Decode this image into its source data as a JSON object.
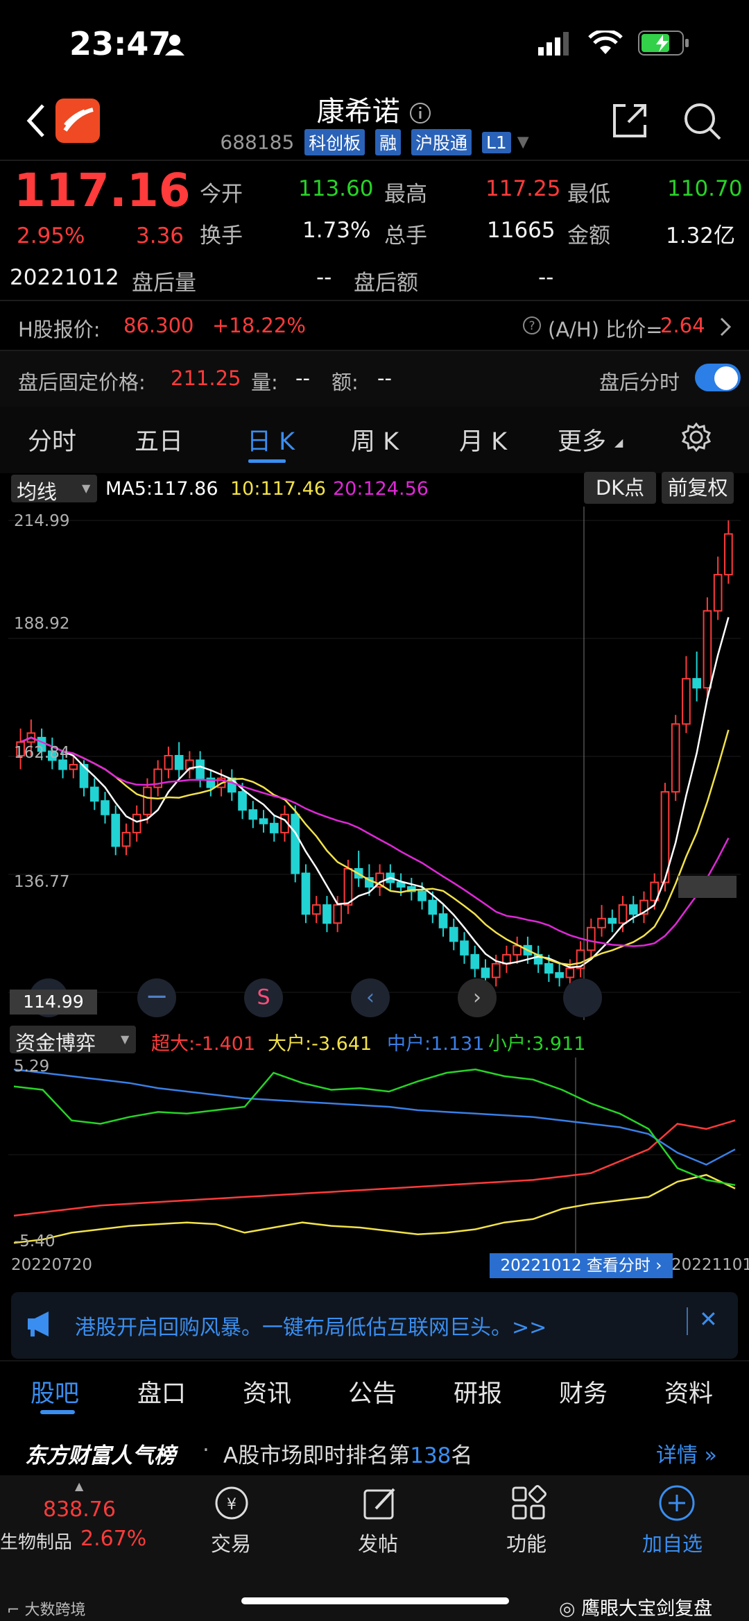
{
  "status_bar": {
    "time": "23:47"
  },
  "header": {
    "title": "康希诺",
    "stock_code": "688185",
    "tags": [
      "科创板",
      "融",
      "沪股通",
      "L1"
    ]
  },
  "quote": {
    "price": "117.16",
    "change_pct": "2.95%",
    "change": "3.36",
    "open_label": "今开",
    "open": "113.60",
    "high_label": "最高",
    "high": "117.25",
    "low_label": "最低",
    "low": "110.70",
    "turnover_label": "换手",
    "turnover": "1.73%",
    "volume_label": "总手",
    "volume": "11665",
    "amount_label": "金额",
    "amount": "1.32亿",
    "date": "20221012",
    "after_vol_label": "盘后量",
    "after_vol": "--",
    "after_amt_label": "盘后额",
    "after_amt": "--"
  },
  "hshare": {
    "label": "H股报价:",
    "price": "86.300",
    "premium": "+18.22%",
    "ah_label": "(A/H) 比价=",
    "ah_value": "2.64"
  },
  "after_hours": {
    "price_label": "盘后固定价格:",
    "price": "211.25",
    "qty_label": "量:",
    "qty": "--",
    "amt_label": "额:",
    "amt": "--",
    "toggle_label": "盘后分时"
  },
  "chart_tabs": [
    "分时",
    "五日",
    "日 K",
    "周 K",
    "月 K",
    "更多"
  ],
  "indicator_bar": {
    "selector": "均线",
    "ma5": "MA5:117.86",
    "ma10": "10:117.46",
    "ma20": "20:124.56",
    "dk_button": "DK点",
    "fq_button": "前复权"
  },
  "price_axis": {
    "top": "214.99",
    "l2": "188.92",
    "l3": "162.84",
    "l4": "136.77",
    "crosshair_price": "114.99"
  },
  "capital_panel": {
    "selector": "资金博弈",
    "super": "超大:-1.401",
    "large": "大户:-3.641",
    "mid": "中户:1.131",
    "small": "小户:3.911",
    "ymax": "5.29",
    "ymin": "-5.40",
    "start_date": "20220720",
    "end_date": "20221101",
    "tip": "20221012 查看分时"
  },
  "chart_data": {
    "type": "candlestick",
    "ylim": [
      110.7,
      214.99
    ],
    "candles": [
      [
        163,
        166,
        160,
        169
      ],
      [
        166,
        168,
        163,
        171
      ],
      [
        167,
        164,
        162,
        169
      ],
      [
        164,
        162,
        160,
        167
      ],
      [
        162,
        160,
        158,
        164
      ],
      [
        160,
        161,
        158,
        163
      ],
      [
        161,
        156,
        154,
        162
      ],
      [
        156,
        153,
        151,
        158
      ],
      [
        153,
        150,
        148,
        155
      ],
      [
        150,
        143,
        141,
        152
      ],
      [
        143,
        146,
        141,
        148
      ],
      [
        146,
        150,
        144,
        152
      ],
      [
        150,
        156,
        148,
        158
      ],
      [
        156,
        160,
        154,
        162
      ],
      [
        160,
        163,
        158,
        165
      ],
      [
        163,
        160,
        158,
        166
      ],
      [
        160,
        162,
        158,
        164
      ],
      [
        162,
        158,
        156,
        164
      ],
      [
        158,
        156,
        154,
        160
      ],
      [
        156,
        158,
        154,
        160
      ],
      [
        158,
        155,
        153,
        160
      ],
      [
        155,
        151,
        149,
        157
      ],
      [
        151,
        149,
        147,
        153
      ],
      [
        149,
        148,
        146,
        151
      ],
      [
        148,
        146,
        144,
        150
      ],
      [
        146,
        150,
        144,
        152
      ],
      [
        150,
        137,
        135,
        152
      ],
      [
        137,
        128,
        126,
        139
      ],
      [
        128,
        130,
        126,
        132
      ],
      [
        130,
        126,
        124,
        132
      ],
      [
        126,
        130,
        124,
        132
      ],
      [
        130,
        138,
        128,
        140
      ],
      [
        138,
        136,
        134,
        142
      ],
      [
        136,
        134,
        132,
        139
      ],
      [
        134,
        137,
        132,
        139
      ],
      [
        137,
        135,
        133,
        139
      ],
      [
        135,
        134,
        132,
        137
      ],
      [
        134,
        133,
        131,
        136
      ],
      [
        133,
        131,
        129,
        135
      ],
      [
        131,
        128,
        126,
        133
      ],
      [
        128,
        125,
        123,
        130
      ],
      [
        125,
        122,
        120,
        127
      ],
      [
        122,
        119,
        117,
        124
      ],
      [
        119,
        116,
        114,
        121
      ],
      [
        116,
        114,
        112,
        118
      ],
      [
        114,
        117,
        112,
        119
      ],
      [
        117,
        119,
        115,
        121
      ],
      [
        119,
        121,
        117,
        123
      ],
      [
        121,
        119,
        117,
        123
      ],
      [
        119,
        117,
        115,
        121
      ],
      [
        117,
        115,
        113,
        119
      ],
      [
        115,
        114,
        112,
        117
      ],
      [
        114,
        116,
        112,
        118
      ],
      [
        116,
        120,
        114,
        122
      ],
      [
        120,
        125,
        118,
        127
      ],
      [
        125,
        127,
        123,
        130
      ],
      [
        127,
        126,
        124,
        129
      ],
      [
        126,
        130,
        124,
        132
      ],
      [
        130,
        128,
        126,
        132
      ],
      [
        128,
        131,
        126,
        133
      ],
      [
        131,
        135,
        129,
        137
      ],
      [
        135,
        155,
        133,
        157
      ],
      [
        155,
        170,
        153,
        172
      ],
      [
        170,
        180,
        168,
        185
      ],
      [
        180,
        178,
        175,
        186
      ],
      [
        178,
        195,
        176,
        198
      ],
      [
        195,
        203,
        193,
        207
      ],
      [
        203,
        212,
        201,
        215
      ]
    ],
    "ma_series": [
      {
        "name": "MA5",
        "color": "#ffffff"
      },
      {
        "name": "MA10",
        "color": "#f2e24a"
      },
      {
        "name": "MA20",
        "color": "#e028d8"
      }
    ],
    "capital_series": [
      {
        "name": "超大",
        "color": "#ff3b3b",
        "values": [
          -3.6,
          -3.4,
          -3.2,
          -3.0,
          -2.9,
          -2.8,
          -2.7,
          -2.6,
          -2.5,
          -2.4,
          -2.3,
          -2.2,
          -2.1,
          -2.0,
          -1.9,
          -1.8,
          -1.7,
          -1.6,
          -1.5,
          -1.3,
          -1.1,
          -0.4,
          0.3,
          1.8,
          1.5,
          2.0
        ]
      },
      {
        "name": "大户",
        "color": "#f2e24a",
        "values": [
          -5.2,
          -5.0,
          -4.6,
          -4.4,
          -4.2,
          -4.1,
          -4.0,
          -4.1,
          -4.6,
          -4.3,
          -4.0,
          -4.2,
          -4.3,
          -4.5,
          -4.7,
          -4.6,
          -4.4,
          -4.0,
          -3.8,
          -3.2,
          -2.9,
          -2.7,
          -2.5,
          -1.6,
          -1.2,
          -2.0
        ]
      },
      {
        "name": "中户",
        "color": "#3a7fe6",
        "values": [
          5.0,
          4.8,
          4.6,
          4.4,
          4.2,
          3.9,
          3.7,
          3.5,
          3.3,
          3.2,
          3.1,
          3.0,
          2.9,
          2.8,
          2.6,
          2.5,
          2.4,
          2.3,
          2.2,
          2.0,
          1.8,
          1.6,
          1.2,
          0.1,
          -0.6,
          0.3
        ]
      },
      {
        "name": "小户",
        "color": "#27d427",
        "values": [
          4.0,
          3.8,
          2.0,
          1.8,
          2.2,
          2.5,
          2.4,
          2.6,
          2.8,
          4.8,
          4.2,
          3.8,
          3.9,
          3.7,
          4.3,
          4.8,
          5.0,
          4.6,
          4.4,
          3.8,
          3.0,
          2.4,
          1.5,
          -0.8,
          -1.5,
          -1.8
        ]
      }
    ]
  },
  "banner": {
    "text": "港股开启回购风暴。一键布局低估互联网巨头。>>"
  },
  "bottom_tabs": [
    "股吧",
    "盘口",
    "资讯",
    "公告",
    "研报",
    "财务",
    "资料"
  ],
  "popularity": {
    "brand": "东方财富人气榜",
    "text": "A股市场即时排名第",
    "rank": "138",
    "suffix": "名",
    "details": "详情"
  },
  "sector": {
    "value": "838.76",
    "name": "生物制品",
    "pct": "2.67%"
  },
  "bottom_nav": [
    "交易",
    "发帖",
    "功能",
    "加自选"
  ],
  "watermark": {
    "left": "大数跨境",
    "right": "鹰眼大宝剑复盘"
  }
}
